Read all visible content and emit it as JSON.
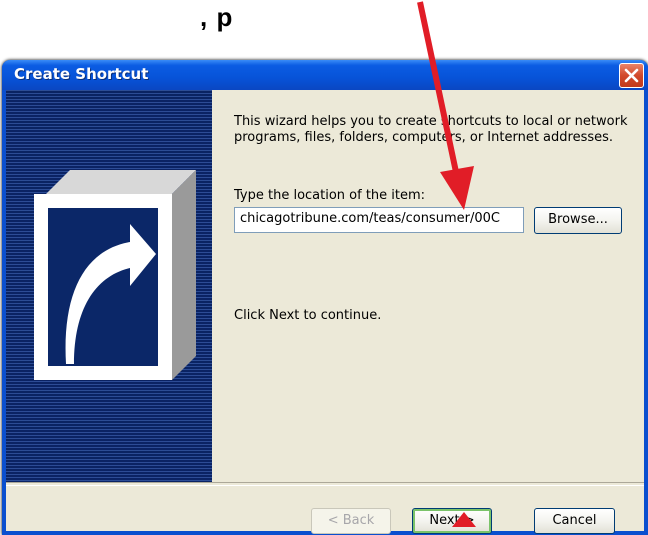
{
  "caption": {
    "text": ", p"
  },
  "window": {
    "title": "Create Shortcut",
    "close_icon": "close-icon"
  },
  "sidebar": {
    "icon": "shortcut-arrow-icon"
  },
  "content": {
    "description": "This wizard helps you to create shortcuts to local or network programs, files, folders, computers, or Internet addresses.",
    "location_label": "Type the location of the item:",
    "location_value": "chicagotribune.com/teas/consumer/00C",
    "browse_label": "Browse...",
    "continue_text": "Click Next to continue."
  },
  "buttons": {
    "back": "< Back",
    "next": "Next >",
    "cancel": "Cancel"
  },
  "annotation": {
    "arrow_color": "#e11d27"
  }
}
